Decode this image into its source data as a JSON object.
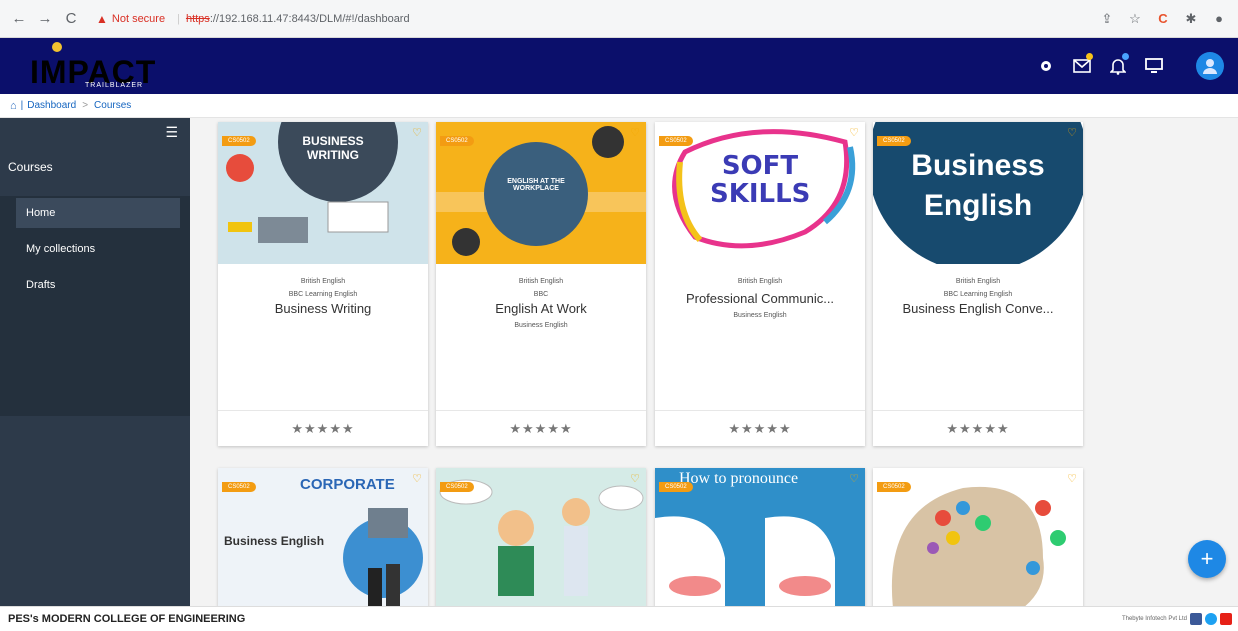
{
  "browser": {
    "security_text": "Not secure",
    "protocol": "https",
    "url_rest": "://192.168.11.47:8443/DLM/#!/dashboard"
  },
  "app": {
    "logo_text": "IMPACT",
    "logo_sub": "TRAILBLAZER",
    "brand_color": "#0b0f6b"
  },
  "breadcrumb": {
    "items": [
      "Dashboard",
      "Courses"
    ]
  },
  "sidebar": {
    "section": "Courses",
    "items": [
      {
        "label": "Home",
        "active": true
      },
      {
        "label": "My collections",
        "active": false
      },
      {
        "label": "Drafts",
        "active": false
      }
    ]
  },
  "courses": [
    {
      "thumb_text": "BUSINESS WRITING",
      "meta1": "British English",
      "meta2": "BBC Learning English",
      "title": "Business Writing",
      "meta3": "",
      "stars": "★★★★★"
    },
    {
      "thumb_text": "ENGLISH AT THE WORKPLACE",
      "meta1": "British English",
      "meta2": "BBC",
      "title": "English At Work",
      "meta3": "Business English",
      "stars": "★★★★★"
    },
    {
      "thumb_text": "SOFT SKILLS",
      "meta1": "British English",
      "meta2": "",
      "title": "Professional Communic...",
      "meta3": "Business English",
      "stars": "★★★★★"
    },
    {
      "thumb_text": "Business English",
      "meta1": "British English",
      "meta2": "BBC Learning English",
      "title": "Business English Conve...",
      "meta3": "",
      "stars": "★★★★★"
    },
    {
      "thumb_text": "CORPORATE",
      "title": ""
    },
    {
      "thumb_text": "",
      "title": ""
    },
    {
      "thumb_text": "How to pronounce",
      "title": ""
    },
    {
      "thumb_text": "",
      "title": ""
    }
  ],
  "footer": {
    "college": "PES's MODERN COLLEGE OF ENGINEERING",
    "credit": "Thebyte Infotech Pvt Ltd"
  }
}
